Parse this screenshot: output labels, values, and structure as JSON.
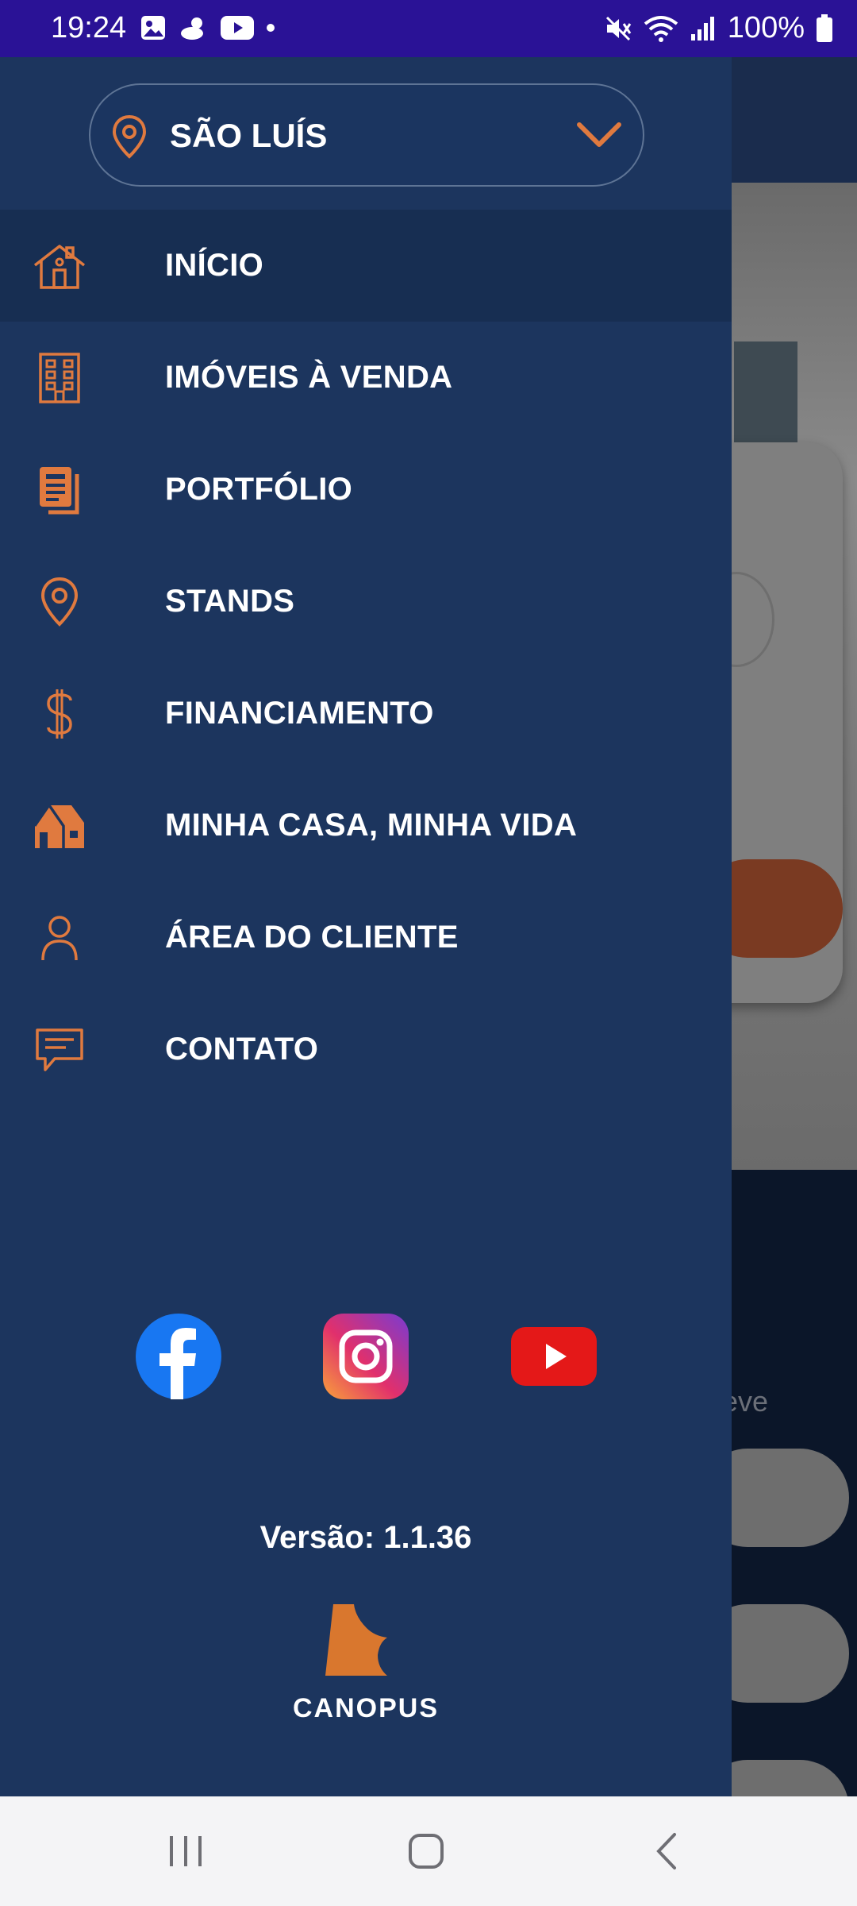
{
  "status_bar": {
    "time": "19:24",
    "battery": "100%",
    "notification_icons": [
      "gallery-icon",
      "weather-icon",
      "youtube-icon",
      "dot-icon"
    ],
    "system_icons": [
      "mute-icon",
      "wifi-icon",
      "signal-icon",
      "battery-icon"
    ]
  },
  "drawer": {
    "city_selector": {
      "value": "SÃO LUÍS",
      "icon": "location-pin-icon",
      "dropdown_icon": "chevron-down-icon"
    },
    "menu": [
      {
        "label": "INÍCIO",
        "icon": "home-icon",
        "active": true
      },
      {
        "label": "IMÓVEIS À VENDA",
        "icon": "building-icon",
        "active": false
      },
      {
        "label": "PORTFÓLIO",
        "icon": "portfolio-icon",
        "active": false
      },
      {
        "label": "STANDS",
        "icon": "location-pin-icon",
        "active": false
      },
      {
        "label": "FINANCIAMENTO",
        "icon": "dollar-icon",
        "active": false
      },
      {
        "label": "MINHA CASA, MINHA VIDA",
        "icon": "house-icon",
        "active": false
      },
      {
        "label": "ÁREA DO CLIENTE",
        "icon": "user-icon",
        "active": false
      },
      {
        "label": "CONTATO",
        "icon": "chat-icon",
        "active": false
      }
    ],
    "social": [
      "facebook-icon",
      "instagram-icon",
      "youtube-icon"
    ],
    "version": "Versão: 1.1.36",
    "logo_text": "CANOPUS"
  },
  "background_page": {
    "partial_text": "eve"
  },
  "colors": {
    "accent": "#e07a3f",
    "drawer_bg": "#1c355e",
    "status_bar": "#2a1296"
  }
}
